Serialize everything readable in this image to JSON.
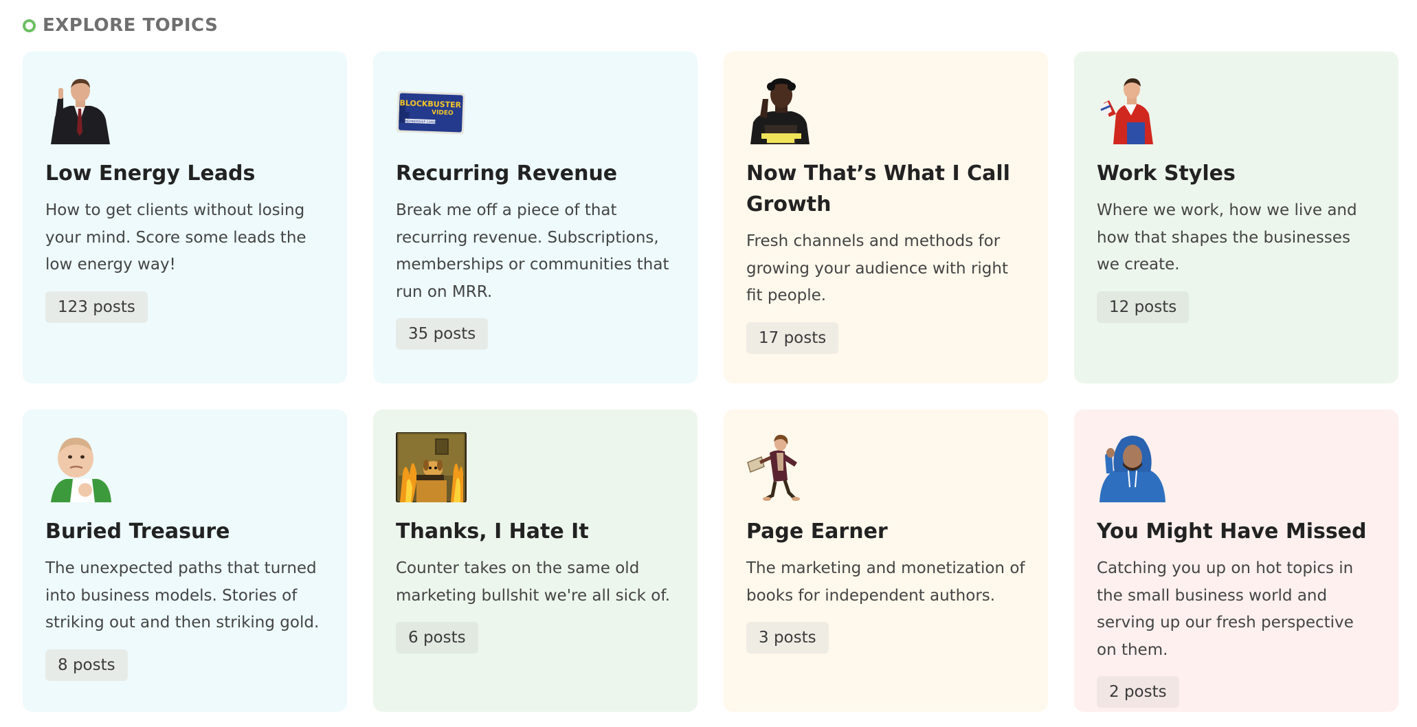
{
  "section": {
    "title": "EXPLORE TOPICS",
    "accent": "#6cbf62"
  },
  "cards": [
    {
      "title": "Low Energy Leads",
      "description": "How to get clients without losing your mind. Score some leads the low energy way!",
      "count": "123 posts",
      "icon": "businessman-gif-icon"
    },
    {
      "title": "Recurring Revenue",
      "description": "Break me off a piece of that recurring revenue. Subscriptions, memberships or communities that run on MRR.",
      "count": "35 posts",
      "icon": "blockbuster-card-icon",
      "card_text": [
        "BLOCKBUSTER",
        "VIDEO",
        "MEMBERSHIP CARD"
      ]
    },
    {
      "title": "Now That’s What I Call Growth",
      "description": "Fresh channels and methods for growing your audience with right fit people.",
      "count": "17 posts",
      "icon": "speaker-gif-icon"
    },
    {
      "title": "Work Styles",
      "description": "Where we work, how we live and how that shapes the businesses we create.",
      "count": "12 posts",
      "icon": "red-jacket-man-icon"
    },
    {
      "title": "Buried Treasure",
      "description": "The unexpected paths that turned into business models. Stories of striking out and then striking gold.",
      "count": "8 posts",
      "icon": "success-kid-icon"
    },
    {
      "title": "Thanks, I Hate It",
      "description": "Counter takes on the same old marketing bullshit we're all sick of.",
      "count": "6 posts",
      "icon": "this-is-fine-dog-icon"
    },
    {
      "title": "Page Earner",
      "description": "The marketing and monetization of books for independent authors.",
      "count": "3 posts",
      "icon": "running-hobbit-icon"
    },
    {
      "title": "You Might Have Missed",
      "description": "Catching you up on hot topics in the small business world and serving up our fresh perspective on them.",
      "count": "2 posts",
      "icon": "blue-hoodie-man-icon"
    }
  ]
}
